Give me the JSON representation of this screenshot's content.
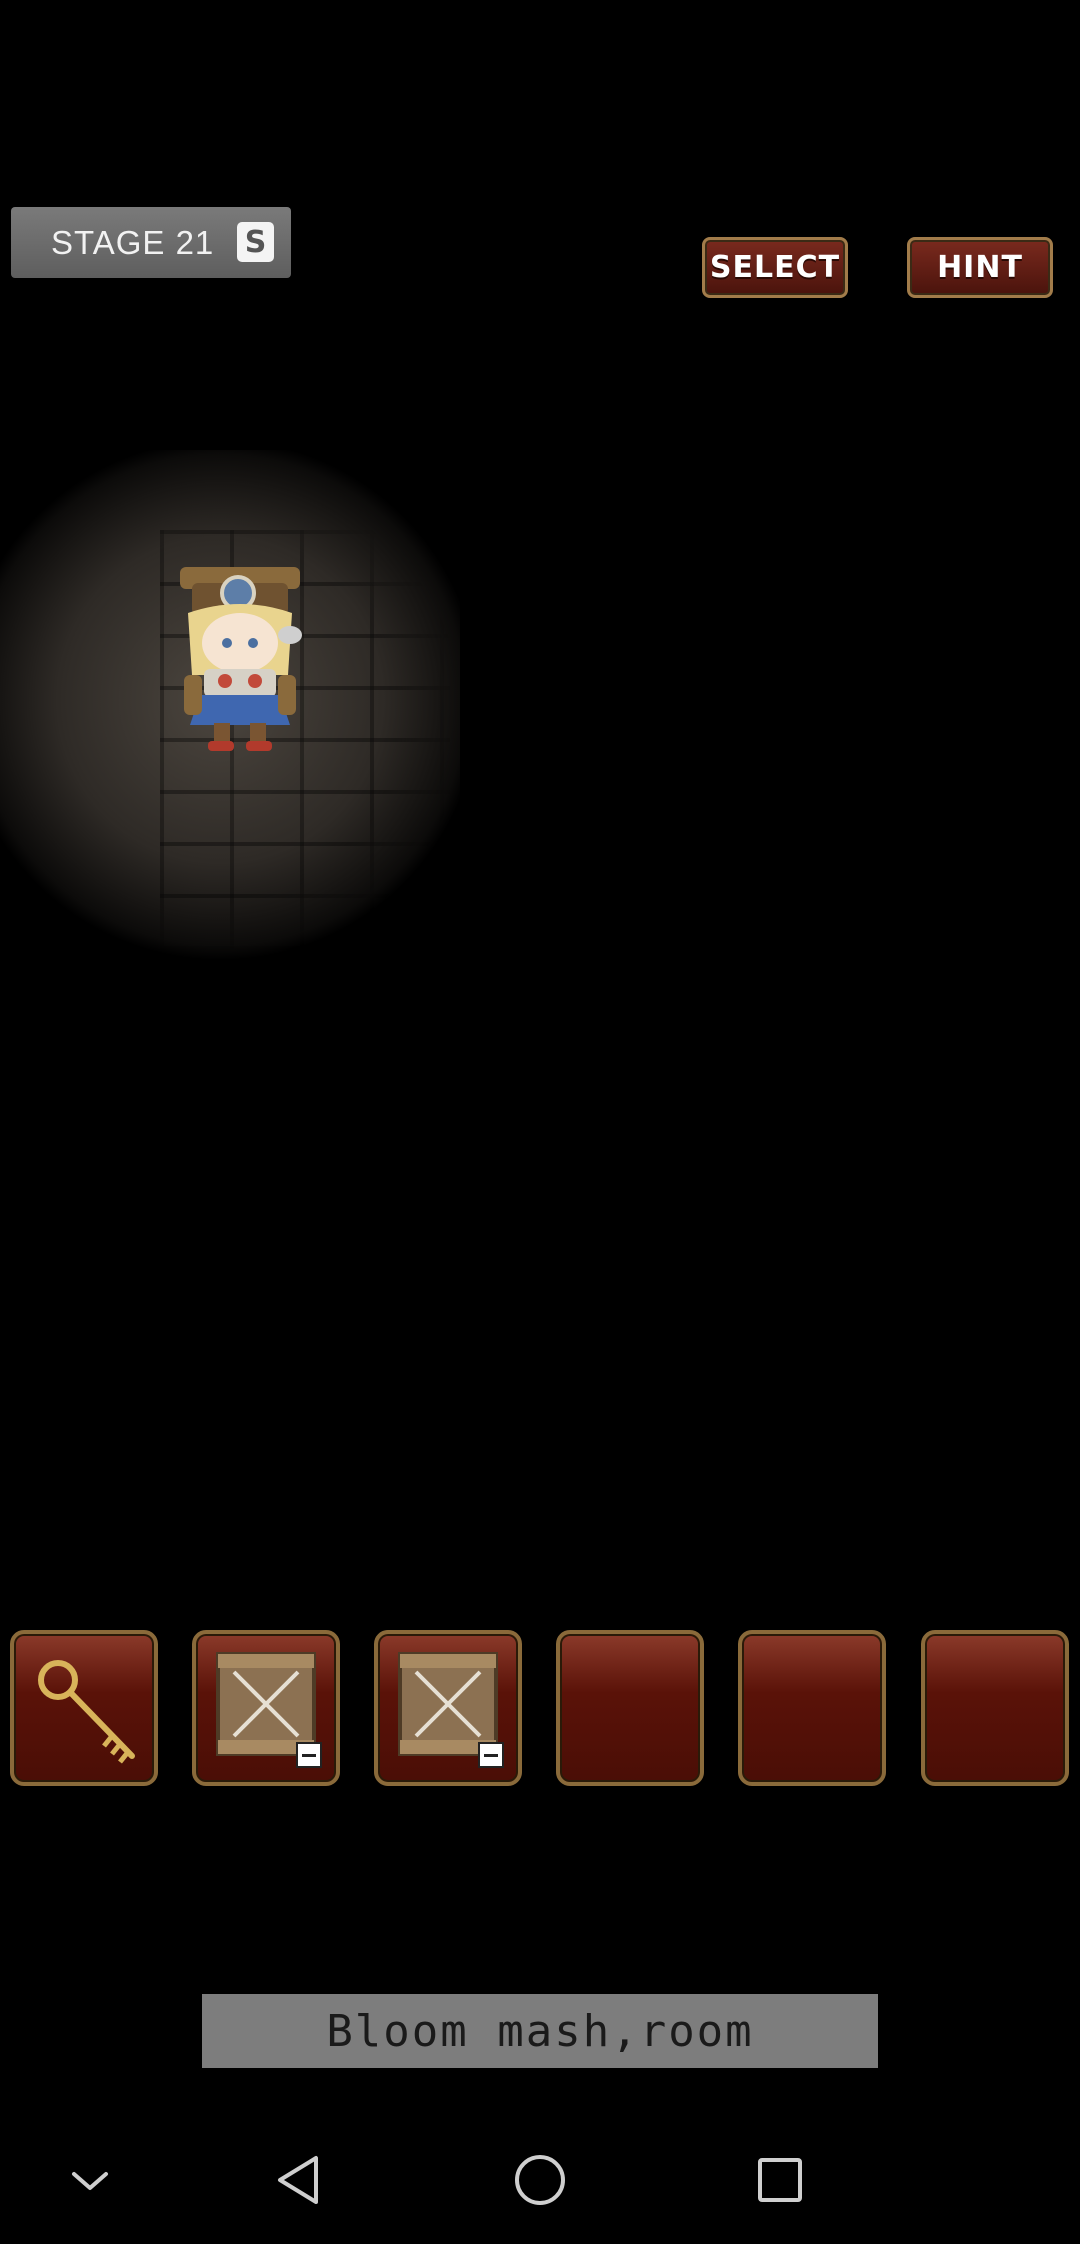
{
  "hud": {
    "stage_label": "STAGE 21",
    "save_icon_glyph": "S",
    "select_label": "SELECT",
    "hint_label": "HINT"
  },
  "inventory": {
    "slots": [
      {
        "item": "key-icon"
      },
      {
        "item": "crate-icon",
        "badge": "minus"
      },
      {
        "item": "crate-icon",
        "badge": "minus"
      },
      {
        "item": null
      },
      {
        "item": null
      },
      {
        "item": null
      }
    ]
  },
  "message": {
    "text": "Bloom mash,room"
  },
  "nav": {
    "items": [
      "collapse-icon",
      "back-icon",
      "home-icon",
      "recents-icon"
    ]
  },
  "colors": {
    "background": "#000000",
    "slot_fill": "#5a1208",
    "slot_border": "#8a6a3a",
    "button_fill": "#6a2014",
    "badge_fill": "#6b6b6b"
  }
}
